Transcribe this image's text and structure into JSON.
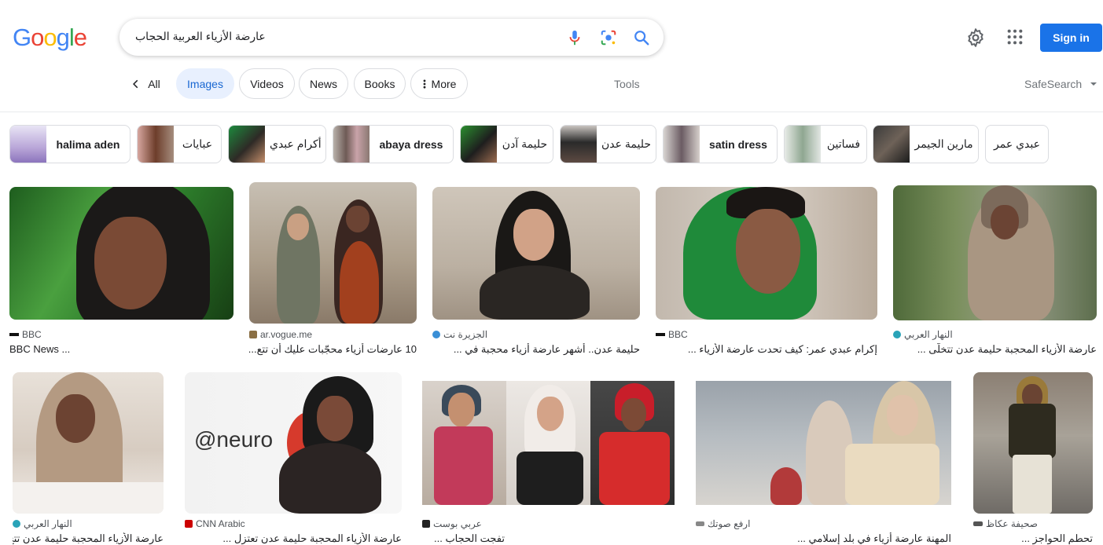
{
  "header": {
    "logo_letters": [
      "G",
      "o",
      "o",
      "g",
      "l",
      "e"
    ],
    "query": "عارضة الأزياء العربية الحجاب",
    "signin_label": "Sign in"
  },
  "tabs": [
    {
      "label": "All"
    },
    {
      "label": "Images"
    },
    {
      "label": "Videos"
    },
    {
      "label": "News"
    },
    {
      "label": "Books"
    },
    {
      "label": "More"
    }
  ],
  "tools_label": "Tools",
  "safesearch_label": "SafeSearch",
  "chips": [
    {
      "label": "halima aden"
    },
    {
      "label": "عبايات"
    },
    {
      "label": "أكرام عبدي"
    },
    {
      "label": "abaya dress"
    },
    {
      "label": "حليمة آدن"
    },
    {
      "label": "حليمة عدن"
    },
    {
      "label": "satin dress"
    },
    {
      "label": "فساتين"
    },
    {
      "label": "مارين الجيمر"
    },
    {
      "label": "عبدي عمر"
    }
  ],
  "results_row1": [
    {
      "source": "BBC",
      "title": "BBC News ..."
    },
    {
      "source": "ar.vogue.me",
      "title": "10 عارضات أزياء محجّبات عليك أن تتع..."
    },
    {
      "source": "الجزيرة نت",
      "title": "حليمة عدن.. أشهر عارضة أزياء محجبة في ..."
    },
    {
      "source": "BBC",
      "title": "إكرام عبدي عمر: كيف تحدت عارضة الأزياء ..."
    },
    {
      "source": "النهار العربي",
      "title": "عارضة الأزياء المحجبة حليمة عدن تتخلّى ..."
    }
  ],
  "results_row2": [
    {
      "source": "النهار العربي",
      "title": "عارضة الأزياء المحجبة حليمة عدن تتخ..."
    },
    {
      "source": "CNN Arabic",
      "title": "عارضة الأزياء المحجبة حليمة عدن تعتزل ..."
    },
    {
      "source": "عربي بوست",
      "title": "تفجت الحجاب ..."
    },
    {
      "source": "ارفع صوتك",
      "title": "المهنة عارضة أزياء في بلد إسلامي ..."
    },
    {
      "source": "صحيفة عكاظ",
      "title": "تحطم الحواجز ..."
    }
  ],
  "colors": {
    "accent": "#1a73e8",
    "active_tab_bg": "#e8f0fe",
    "active_tab_text": "#1967d2"
  }
}
